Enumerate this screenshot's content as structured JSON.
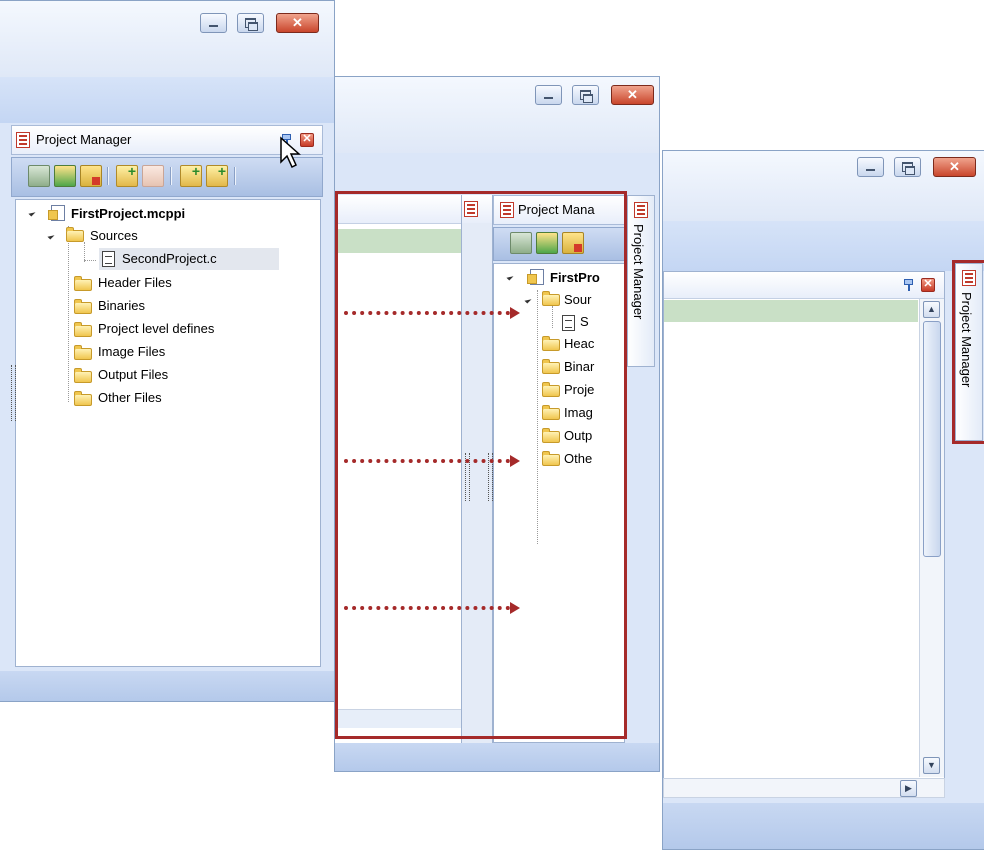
{
  "panel": {
    "title": "Project Manager",
    "title_truncated": "Project Mana",
    "vertical_tab": "Project Manager"
  },
  "tree": {
    "root": "FirstProject.mcppi",
    "root_truncated": "FirstPro",
    "sources": "Sources",
    "sources_truncated": "Sour",
    "file": "SecondProject.c",
    "file_truncated": "S",
    "header": "Header Files",
    "header_truncated": "Heac",
    "binaries": "Binaries",
    "binaries_truncated": "Binar",
    "defines": "Project level defines",
    "defines_truncated": "Proje",
    "images": "Image Files",
    "images_truncated": "Imag",
    "output": "Output Files",
    "output_truncated": "Outp",
    "other": "Other Files",
    "other_truncated": "Othe"
  },
  "icons": {
    "window_minimize": "minimize-icon",
    "window_restore": "restore-icon",
    "window_close": "close-icon",
    "pin": "pin-icon",
    "panel_close": "close-icon",
    "folder": "folder-icon",
    "file": "file-icon",
    "project": "project-icon",
    "scroll_up": "chevron-up-icon",
    "scroll_down": "chevron-down-icon",
    "scroll_right": "chevron-right-icon"
  },
  "colors": {
    "annotation": "#a52a2a",
    "window_bg": "#dbe6f8",
    "selection_green": "#c9e0c6"
  }
}
